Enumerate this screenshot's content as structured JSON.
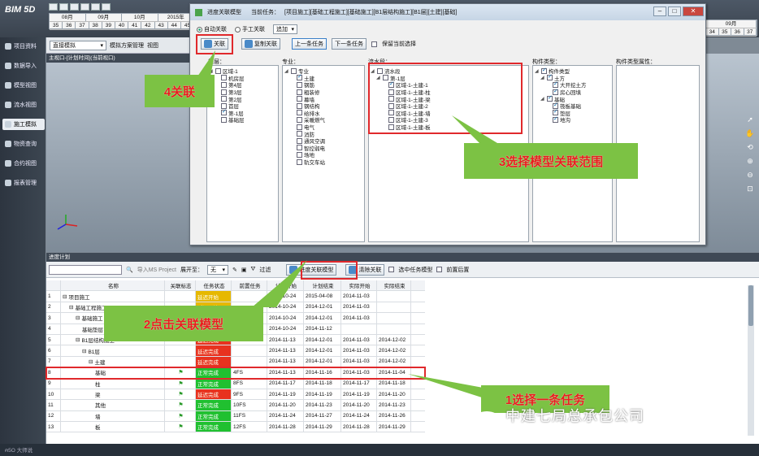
{
  "app": {
    "logo": "BIM 5D",
    "year_label": "2015年",
    "months_top": [
      "08月",
      "09月",
      "10月"
    ],
    "weeks_top": [
      "35",
      "36",
      "37",
      "38",
      "39",
      "40",
      "41",
      "42",
      "43",
      "44",
      "45"
    ],
    "months_right": [
      "09月"
    ],
    "weeks_right": [
      "34",
      "35",
      "36",
      "37"
    ]
  },
  "sidebar": {
    "items": [
      {
        "label": "项目资料",
        "icon": "folder-icon"
      },
      {
        "label": "数据导入",
        "icon": "import-icon"
      },
      {
        "label": "模型视图",
        "icon": "cube-icon"
      },
      {
        "label": "流水视图",
        "icon": "flow-icon"
      },
      {
        "label": "施工模拟",
        "icon": "simulation-icon"
      },
      {
        "label": "物资查询",
        "icon": "search-icon"
      },
      {
        "label": "合约视图",
        "icon": "contract-icon"
      },
      {
        "label": "报表管理",
        "icon": "report-icon"
      }
    ],
    "active_index": 4
  },
  "toolbar2": {
    "mode": "直接模拟",
    "plan_manage": "模拟方案管理",
    "view": "视图"
  },
  "viewport": {
    "title": "主视口-[计划时间](当前视口)"
  },
  "dialog": {
    "title": "进度关联模型",
    "current_task_label": "当前任务：",
    "current_task": "[项目施工][基础工程施工][基础施工][B1层结构施工][B1层][土建][基础]",
    "auto_link": "自动关联",
    "manual_link": "手工关联",
    "select_mode": "追加",
    "link_btn": "关联",
    "copy_link_btn": "复制关联",
    "prev_task_btn": "上一条任务",
    "next_task_btn": "下一条任务",
    "keep_selection": "保留当前选择",
    "col_floor": "楼层：",
    "col_major": "专业：",
    "col_flow": "流水段：",
    "col_type": "构件类型：",
    "col_attr": "构件类型属性：",
    "floors": [
      {
        "label": "区域-1",
        "level": 0,
        "checked": false
      },
      {
        "label": "机房层",
        "level": 1,
        "checked": false
      },
      {
        "label": "第4层",
        "level": 1,
        "checked": false
      },
      {
        "label": "第3层",
        "level": 1,
        "checked": false
      },
      {
        "label": "第2层",
        "level": 1,
        "checked": false
      },
      {
        "label": "首层",
        "level": 1,
        "checked": false
      },
      {
        "label": "第-1层",
        "level": 1,
        "checked": true
      },
      {
        "label": "基础层",
        "level": 1,
        "checked": false
      }
    ],
    "majors": [
      {
        "label": "专业",
        "level": 0,
        "checked": false
      },
      {
        "label": "土建",
        "level": 1,
        "checked": true
      },
      {
        "label": "钢筋",
        "level": 1,
        "checked": false
      },
      {
        "label": "粗装修",
        "level": 1,
        "checked": false
      },
      {
        "label": "幕墙",
        "level": 1,
        "checked": false
      },
      {
        "label": "钢结构",
        "level": 1,
        "checked": false
      },
      {
        "label": "给排水",
        "level": 1,
        "checked": false
      },
      {
        "label": "采暖燃气",
        "level": 1,
        "checked": false
      },
      {
        "label": "电气",
        "level": 1,
        "checked": false
      },
      {
        "label": "消防",
        "level": 1,
        "checked": false
      },
      {
        "label": "通风空调",
        "level": 1,
        "checked": false
      },
      {
        "label": "智控弱电",
        "level": 1,
        "checked": false
      },
      {
        "label": "场地",
        "level": 1,
        "checked": false
      },
      {
        "label": "轨交车站",
        "level": 1,
        "checked": false
      }
    ],
    "flows": [
      {
        "label": "流水段",
        "level": 0,
        "checked": false
      },
      {
        "label": "第-1层",
        "level": 1,
        "checked": false
      },
      {
        "label": "区域-1-土建-1",
        "level": 2,
        "checked": true
      },
      {
        "label": "区域-1-土建-柱",
        "level": 2,
        "checked": false
      },
      {
        "label": "区域-1-土建-梁",
        "level": 2,
        "checked": false
      },
      {
        "label": "区域-1-土建-2",
        "level": 2,
        "checked": false
      },
      {
        "label": "区域-1-土建-墙",
        "level": 2,
        "checked": false
      },
      {
        "label": "区域-1-土建-3",
        "level": 2,
        "checked": false
      },
      {
        "label": "区域-1-土建-板",
        "level": 2,
        "checked": false
      }
    ],
    "types": [
      {
        "label": "构件类型",
        "level": 0,
        "checked": true
      },
      {
        "label": "土方",
        "level": 1,
        "checked": true
      },
      {
        "label": "大开挖土方",
        "level": 2,
        "checked": true
      },
      {
        "label": "房心回填",
        "level": 2,
        "checked": true
      },
      {
        "label": "基础",
        "level": 1,
        "checked": true
      },
      {
        "label": "筏板基础",
        "level": 2,
        "checked": true
      },
      {
        "label": "垫层",
        "level": 2,
        "checked": true
      },
      {
        "label": "地沟",
        "level": 2,
        "checked": true
      }
    ]
  },
  "plan": {
    "title": "进度计划",
    "import_project": "导入MS Project",
    "expand_label": "展开至：",
    "expand_value": "无",
    "filter": "过滤",
    "link_model_btn": "进度关联模型",
    "clear_link_btn": "清除关联",
    "select_task_model": "选中任务模型",
    "pre_post": "前置后置",
    "columns": [
      "",
      "名称",
      "关联标志",
      "任务状态",
      "前置任务",
      "计划开始",
      "计划结束",
      "实际开始",
      "实际结束"
    ],
    "rows": [
      {
        "no": "1",
        "name": "项目施工",
        "indent": 0,
        "tree": "⊟",
        "flag": "",
        "status": "延迟开始",
        "status_color": "yel",
        "pred": "",
        "ps": "2014-10-24",
        "pe": "2015-04-08",
        "as": "2014-11-03",
        "ae": ""
      },
      {
        "no": "2",
        "name": "基础工程施工",
        "indent": 1,
        "tree": "⊟",
        "flag": "",
        "status": "延迟开始",
        "status_color": "yel",
        "pred": "",
        "ps": "2014-10-24",
        "pe": "2014-12-01",
        "as": "2014-11-03",
        "ae": ""
      },
      {
        "no": "3",
        "name": "基础施工",
        "indent": 2,
        "tree": "⊟",
        "flag": "",
        "status": "延迟开始",
        "status_color": "yel",
        "pred": "",
        "ps": "2014-10-24",
        "pe": "2014-12-01",
        "as": "2014-11-03",
        "ae": ""
      },
      {
        "no": "4",
        "name": "基础垫层",
        "indent": 3,
        "tree": "",
        "flag": "",
        "status": "",
        "status_color": "",
        "pred": "",
        "ps": "2014-10-24",
        "pe": "2014-11-12",
        "as": "",
        "ae": ""
      },
      {
        "no": "5",
        "name": "B1层结构施工",
        "indent": 2,
        "tree": "⊟",
        "flag": "",
        "status": "延迟完成",
        "status_color": "red",
        "pred": "",
        "ps": "2014-11-13",
        "pe": "2014-12-01",
        "as": "2014-11-03",
        "ae": "2014-12-02"
      },
      {
        "no": "6",
        "name": "B1层",
        "indent": 3,
        "tree": "⊟",
        "flag": "",
        "status": "延迟完成",
        "status_color": "red",
        "pred": "",
        "ps": "2014-11-13",
        "pe": "2014-12-01",
        "as": "2014-11-03",
        "ae": "2014-12-02"
      },
      {
        "no": "7",
        "name": "土建",
        "indent": 4,
        "tree": "⊟",
        "flag": "",
        "status": "延迟完成",
        "status_color": "red",
        "pred": "",
        "ps": "2014-11-13",
        "pe": "2014-12-01",
        "as": "2014-11-03",
        "ae": "2014-12-02"
      },
      {
        "no": "8",
        "name": "基础",
        "indent": 5,
        "tree": "",
        "flag": "⚑",
        "status": "正常完成",
        "status_color": "green",
        "pred": "4FS",
        "ps": "2014-11-13",
        "pe": "2014-11-16",
        "as": "2014-11-03",
        "ae": "2014-11-04"
      },
      {
        "no": "9",
        "name": "柱",
        "indent": 5,
        "tree": "",
        "flag": "⚑",
        "status": "正常完成",
        "status_color": "green",
        "pred": "8FS",
        "ps": "2014-11-17",
        "pe": "2014-11-18",
        "as": "2014-11-17",
        "ae": "2014-11-18"
      },
      {
        "no": "10",
        "name": "梁",
        "indent": 5,
        "tree": "",
        "flag": "⚑",
        "status": "延迟完成",
        "status_color": "red",
        "pred": "9FS",
        "ps": "2014-11-19",
        "pe": "2014-11-19",
        "as": "2014-11-19",
        "ae": "2014-11-20"
      },
      {
        "no": "11",
        "name": "其他",
        "indent": 5,
        "tree": "",
        "flag": "⚑",
        "status": "正常完成",
        "status_color": "green",
        "pred": "10FS",
        "ps": "2014-11-20",
        "pe": "2014-11-23",
        "as": "2014-11-20",
        "ae": "2014-11-23"
      },
      {
        "no": "12",
        "name": "墙",
        "indent": 5,
        "tree": "",
        "flag": "⚑",
        "status": "正常完成",
        "status_color": "green",
        "pred": "11FS",
        "ps": "2014-11-24",
        "pe": "2014-11-27",
        "as": "2014-11-24",
        "ae": "2014-11-26"
      },
      {
        "no": "13",
        "name": "板",
        "indent": 5,
        "tree": "",
        "flag": "⚑",
        "status": "正常完成",
        "status_color": "green",
        "pred": "12FS",
        "ps": "2014-11-28",
        "pe": "2014-11-29",
        "as": "2014-11-28",
        "ae": "2014-11-29"
      }
    ]
  },
  "annotations": {
    "step1": "1选择一条任务",
    "step2": "2点击关联模型",
    "step3": "3选择模型关联范围",
    "step4": "4关联"
  },
  "watermark": "中建七局总承包公司",
  "statusbar": {
    "left": "ꞥ5O 大师说"
  },
  "colors": {
    "highlight_red": "#e0292c",
    "callout_green": "#7cc244",
    "status_red": "#e8321f",
    "status_green": "#20c030",
    "status_yellow": "#e6b800"
  }
}
